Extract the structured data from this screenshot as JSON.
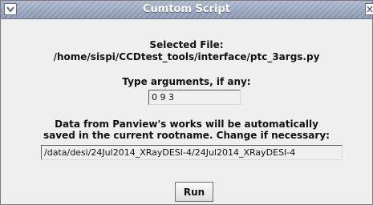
{
  "window": {
    "title": "Cumtom Script"
  },
  "selected_file": {
    "label": "Selected File:",
    "path": "/home/sispi/CCDtest_tools/interface/ptc_3args.py"
  },
  "arguments": {
    "label": "Type arguments, if any:",
    "value": "0 9 3"
  },
  "rootname": {
    "line1": "Data from Panview's works will be automatically",
    "line2": "saved in the current rootname. Change if necessary:",
    "value": "/data/desi/24Jul2014_XRayDESI-4/24Jul2014_XRayDESI-4"
  },
  "actions": {
    "run_label": "Run"
  }
}
